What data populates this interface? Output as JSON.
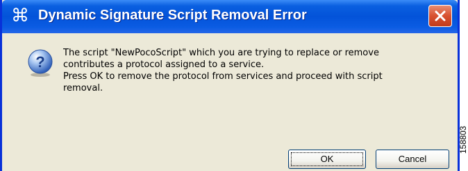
{
  "window": {
    "title": "Dynamic Signature Script Removal Error",
    "title_icon": "⌘",
    "close_icon": "close-icon"
  },
  "dialog": {
    "message_line1": "The script \"NewPocoScript\" which you are trying to replace or remove contributes a protocol assigned to a service.",
    "message_line2": "Press OK to remove the protocol from services and proceed with script removal.",
    "ok_label": "OK",
    "cancel_label": "Cancel"
  },
  "figure_id": "158803",
  "colors": {
    "title_bar": "#0353d9",
    "body_bg": "#ece9d8",
    "close_button": "#d8512f"
  }
}
